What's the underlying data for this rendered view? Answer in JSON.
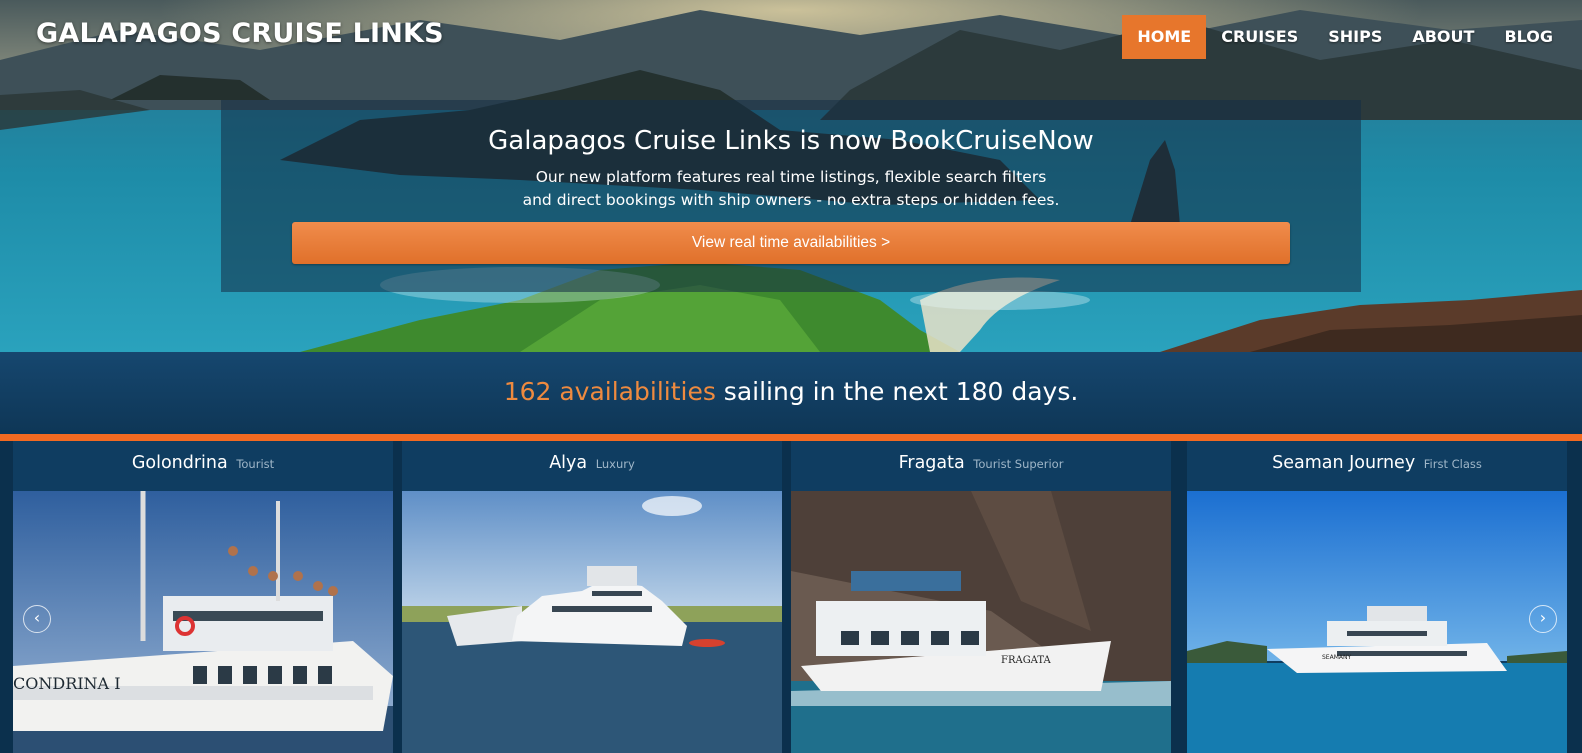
{
  "site": {
    "brand": "GALAPAGOS CRUISE LINKS"
  },
  "nav": {
    "items": [
      "HOME",
      "CRUISES",
      "SHIPS",
      "ABOUT",
      "BLOG"
    ],
    "active": "HOME"
  },
  "promo": {
    "heading": "Galapagos Cruise Links is now BookCruiseNow",
    "line1": "Our new platform features real time listings, flexible search filters",
    "line2": "and direct bookings with ship owners - no extra steps or hidden fees.",
    "cta": "View real time availabilities >"
  },
  "availability": {
    "count_text": "162 availabilities",
    "rest_text": " sailing in the next 180 days."
  },
  "ships": [
    {
      "name": "Golondrina",
      "class": "Tourist"
    },
    {
      "name": "Alya",
      "class": "Luxury"
    },
    {
      "name": "Fragata",
      "class": "Tourist Superior"
    },
    {
      "name": "Seaman Journey",
      "class": "First Class"
    }
  ],
  "carousel": {
    "prev_icon": "‹",
    "next_icon": "›"
  },
  "colors": {
    "accent": "#e7762c",
    "band": "#16476f",
    "card": "#0f3d61"
  }
}
